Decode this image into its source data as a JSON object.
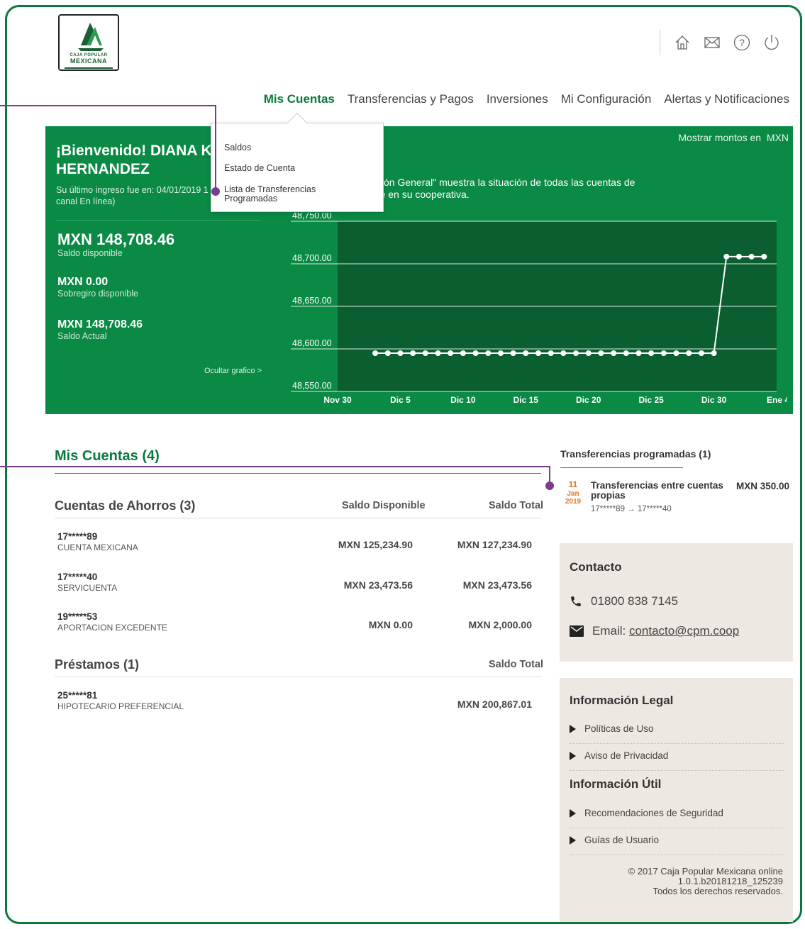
{
  "brand": {
    "logo_line1": "CAJA POPULAR",
    "logo_line2": "MEXICANA",
    "green": "#0a8a45",
    "accent_orange": "#e8731c",
    "callout_purple": "#7a3d8c"
  },
  "top_icons": [
    "home-icon",
    "mail-icon",
    "help-icon",
    "power-icon"
  ],
  "nav": {
    "items": [
      "Mis Cuentas",
      "Transferencias y Pagos",
      "Inversiones",
      "Mi Configuración",
      "Alertas y Notificaciones"
    ],
    "active": "Mis Cuentas"
  },
  "dropdown": {
    "items": [
      "Saldos",
      "Estado de Cuenta",
      "Lista de Transferencias Programadas"
    ]
  },
  "welcome": {
    "greeting": "¡Bienvenido! DIANA K Y",
    "greeting2": "HERNANDEZ",
    "last_login": "Su último ingreso fue en: 04/01/2019 1",
    "last_login2": "canal En línea)"
  },
  "balances": [
    {
      "amount": "MXN 148,708.46",
      "label": "Saldo disponible"
    },
    {
      "amount": "MXN 0.00",
      "label": "Sobregiro disponible"
    },
    {
      "amount": "MXN 148,708.46",
      "label": "Saldo Actual"
    }
  ],
  "ocultar": "Ocultar grafico >",
  "currency": {
    "label": "Mostrar montos en",
    "value": "MXN"
  },
  "chart_description": {
    "line1": "ipción General\" muestra la situación de todas las cuentas de",
    "line2": "ene en su cooperativa."
  },
  "chart_data": {
    "type": "line",
    "xlabels": [
      "Nov 30",
      "Dic 5",
      "Dic 10",
      "Dic 15",
      "Dic 20",
      "Dic 25",
      "Dic 30",
      "Ene 4"
    ],
    "ylabels": [
      "48,750.00",
      "48,700.00",
      "48,650.00",
      "48,600.00",
      "48,550.00"
    ],
    "ylim": [
      48550,
      48750
    ],
    "series": [
      {
        "x_start": "Dic 3",
        "x_end": "Ene 3",
        "values": [
          48595,
          48595,
          48595,
          48595,
          48595,
          48595,
          48595,
          48595,
          48595,
          48595,
          48595,
          48595,
          48595,
          48595,
          48595,
          48595,
          48595,
          48595,
          48595,
          48595,
          48595,
          48595,
          48595,
          48595,
          48595,
          48595,
          48595,
          48595,
          48708.46,
          48708.46,
          48708.46,
          48708.46
        ]
      }
    ]
  },
  "accounts": {
    "title": "Mis Cuentas (4)",
    "savings": {
      "title": "Cuentas de Ahorros (3)",
      "col1": "Saldo Disponible",
      "col2": "Saldo Total",
      "rows": [
        {
          "number": "17*****89",
          "name": "CUENTA MEXICANA",
          "available": "MXN 125,234.90",
          "total": "MXN 127,234.90"
        },
        {
          "number": "17*****40",
          "name": "SERVICUENTA",
          "available": "MXN 23,473.56",
          "total": "MXN 23,473.56"
        },
        {
          "number": "19*****53",
          "name": "APORTACION EXCEDENTE",
          "available": "MXN 0.00",
          "total": "MXN 2,000.00"
        }
      ]
    },
    "loans": {
      "title": "Préstamos (1)",
      "col": "Saldo Total",
      "rows": [
        {
          "number": "25*****81",
          "name": "HIPOTECARIO PREFERENCIAL",
          "total": "MXN 200,867.01"
        }
      ]
    }
  },
  "scheduled": {
    "title": "Transferencias programadas (1)",
    "day": "11",
    "month": "Jan",
    "year": "2019",
    "desc": "Transferencias entre cuentas propias",
    "sub": "17*****89 → 17*****40",
    "amount": "MXN 350.00"
  },
  "contact": {
    "title": "Contacto",
    "phone": "01800 838 7145",
    "email_label": "Email:",
    "email": "contacto@cpm.coop"
  },
  "legal": {
    "title": "Información Legal",
    "items": [
      "Políticas de Uso",
      "Aviso de Privacidad"
    ],
    "useful_title": "Información Útil",
    "useful_items": [
      "Recomendaciones de Seguridad",
      "Guías de Usuario"
    ],
    "copyright1": "©  2017 Caja Popular Mexicana online",
    "copyright2": "1.0.1.b20181218_125239",
    "copyright3": "Todos los derechos reservados."
  }
}
